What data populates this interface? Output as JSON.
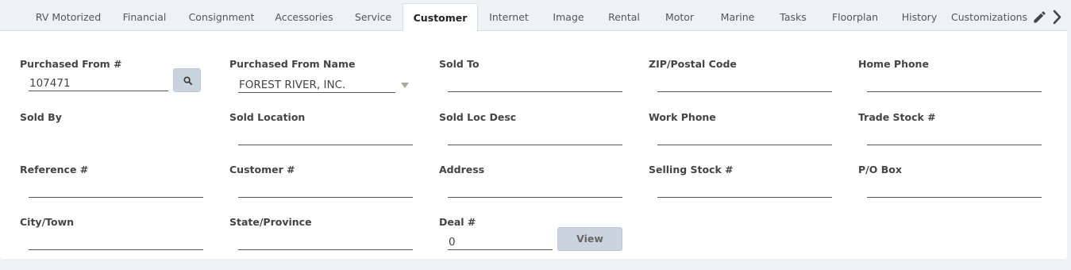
{
  "tabs": [
    {
      "label": "RV Motorized",
      "active": false
    },
    {
      "label": "Financial",
      "active": false
    },
    {
      "label": "Consignment",
      "active": false
    },
    {
      "label": "Accessories",
      "active": false
    },
    {
      "label": "Service",
      "active": false
    },
    {
      "label": "Customer",
      "active": true
    },
    {
      "label": "Internet",
      "active": false
    },
    {
      "label": "Image",
      "active": false
    },
    {
      "label": "Rental",
      "active": false
    },
    {
      "label": "Motor",
      "active": false
    },
    {
      "label": "Marine",
      "active": false
    },
    {
      "label": "Tasks",
      "active": false
    },
    {
      "label": "Floorplan",
      "active": false
    },
    {
      "label": "History",
      "active": false
    },
    {
      "label": "Customizations",
      "active": false
    }
  ],
  "tab_icons": {
    "edit": "pencil-icon",
    "next": "chevron-right-icon"
  },
  "fields": {
    "purchased_from_num": {
      "label": "Purchased From #",
      "value": "107471"
    },
    "purchased_from_name": {
      "label": "Purchased From Name",
      "value": "FOREST RIVER, INC."
    },
    "sold_to": {
      "label": "Sold To",
      "value": ""
    },
    "zip": {
      "label": "ZIP/Postal Code",
      "value": ""
    },
    "home_phone": {
      "label": "Home Phone",
      "value": ""
    },
    "sold_by": {
      "label": "Sold By",
      "value": ""
    },
    "sold_location": {
      "label": "Sold Location",
      "value": ""
    },
    "sold_loc_desc": {
      "label": "Sold Loc Desc",
      "value": ""
    },
    "work_phone": {
      "label": "Work Phone",
      "value": ""
    },
    "trade_stock": {
      "label": "Trade Stock #",
      "value": ""
    },
    "reference": {
      "label": "Reference #",
      "value": ""
    },
    "customer_num": {
      "label": "Customer #",
      "value": ""
    },
    "address": {
      "label": "Address",
      "value": ""
    },
    "selling_stock": {
      "label": "Selling Stock #",
      "value": ""
    },
    "po_box": {
      "label": "P/O Box",
      "value": ""
    },
    "city": {
      "label": "City/Town",
      "value": ""
    },
    "state": {
      "label": "State/Province",
      "value": ""
    },
    "deal_num": {
      "label": "Deal #",
      "value": "0"
    }
  },
  "buttons": {
    "view_label": "View",
    "search_icon": "search-icon"
  },
  "colors": {
    "background": "#eff2f5",
    "panel": "#ffffff",
    "button": "#c9d4df"
  }
}
